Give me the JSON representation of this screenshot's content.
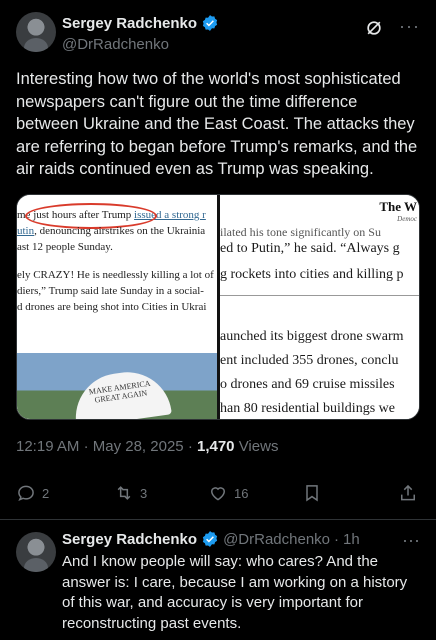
{
  "post": {
    "author_name": "Sergey Radchenko",
    "author_handle": "@DrRadchenko",
    "text": "Interesting how two of the world's most sophisticated newspapers can't figure out the time difference between Ukraine and the East Coast. The attacks they are referring to began before Trump's remarks, and the air raids continued even as Trump was speaking.",
    "time": "12:19 AM",
    "date": "May 28, 2025",
    "views_count": "1,470",
    "views_label": "Views",
    "replies": "2",
    "reposts": "3",
    "likes": "16"
  },
  "media": {
    "left_clip": {
      "line1_prefix": "me ",
      "line1_circled": "just hours after Trump",
      "line1_link": "issued a strong r",
      "line2_link": "utin",
      "line2_rest": ", denouncing airstrikes on the Ukrainia",
      "line3": "ast 12 people Sunday.",
      "line4": "ely CRAZY! He is needlessly killing a lot of",
      "line5": "diers,” Trump said late Sunday in a social-",
      "line6": "d drones are being shot into Cities in Ukrai",
      "hat_text": "MAKE AMERICA GREAT AGAIN"
    },
    "right_clip": {
      "logo": "The W",
      "logo_sub": "Democ",
      "line1": "ilated his tone significantly on Su",
      "line2": "ed to Putin,” he said. “Always g",
      "line3": "g rockets into cities and killing p",
      "line4": "aunched its biggest drone swarm",
      "line5": "ent included 355 drones, conclu",
      "line6": "o drones and 69 cruise missiles",
      "line7": "han 80 residential buildings we"
    }
  },
  "reply": {
    "author_name": "Sergey Radchenko",
    "author_handle": "@DrRadchenko",
    "age": "1h",
    "text": "And I know people will say: who cares? And the answer is: I care, because I am working on a history of this war, and accuracy is very important for reconstructing past events."
  },
  "colors": {
    "background": "#000000",
    "text": "#e7e9ea",
    "muted": "#71767b",
    "verified": "#1d9bf0",
    "separator": "#2f3336"
  },
  "icons": [
    "verified-badge-icon",
    "grok-icon",
    "more-icon",
    "reply-icon",
    "repost-icon",
    "like-icon",
    "bookmark-icon",
    "share-icon"
  ]
}
